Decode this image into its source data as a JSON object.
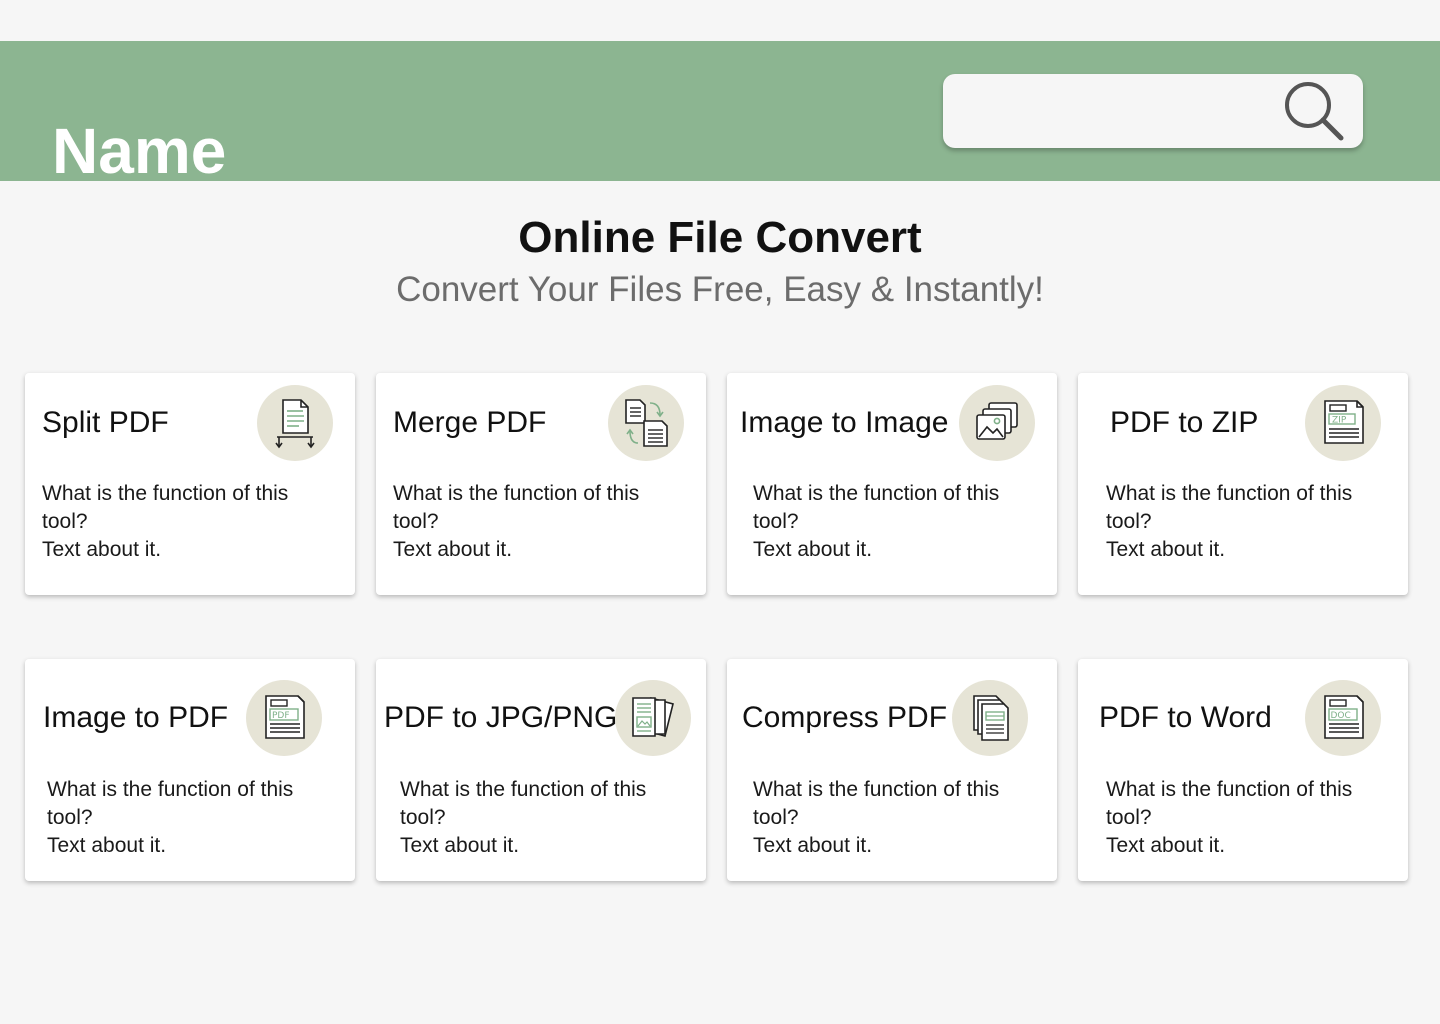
{
  "header": {
    "brand": "Name",
    "search": {
      "placeholder": "",
      "value": ""
    }
  },
  "hero": {
    "title": "Online File Convert",
    "subtitle": "Convert Your Files Free, Easy & Instantly!"
  },
  "tools": [
    {
      "title": "Split PDF",
      "icon": "split-pdf-icon",
      "desc_line1": "What is the function of this",
      "desc_line2": "tool?",
      "desc_line3": "Text about it."
    },
    {
      "title": "Merge PDF",
      "icon": "merge-pdf-icon",
      "desc_line1": "What is the function of this",
      "desc_line2": "tool?",
      "desc_line3": "Text about it."
    },
    {
      "title": "Image to Image",
      "icon": "image-to-image-icon",
      "desc_line1": "What is the function of this",
      "desc_line2": "tool?",
      "desc_line3": "Text about it."
    },
    {
      "title": "PDF to ZIP",
      "icon": "pdf-to-zip-icon",
      "icon_label": "ZIP",
      "desc_line1": "What is the function of this",
      "desc_line2": "tool?",
      "desc_line3": "Text about it."
    },
    {
      "title": "Image to PDF",
      "icon": "image-to-pdf-icon",
      "icon_label": "PDF",
      "desc_line1": "What is the function of this",
      "desc_line2": "tool?",
      "desc_line3": "Text about it."
    },
    {
      "title": "PDF to JPG/PNG",
      "icon": "pdf-to-jpg-png-icon",
      "desc_line1": "What is the function of this",
      "desc_line2": "tool?",
      "desc_line3": "Text about it."
    },
    {
      "title": "Compress PDF",
      "icon": "compress-pdf-icon",
      "desc_line1": "What is the function of this",
      "desc_line2": "tool?",
      "desc_line3": "Text about it."
    },
    {
      "title": "PDF to Word",
      "icon": "pdf-to-word-icon",
      "icon_label": "DOC",
      "desc_line1": "What is the function of this",
      "desc_line2": "tool?",
      "desc_line3": "Text about it."
    }
  ],
  "colors": {
    "header": "#8cb591",
    "background": "#f6f6f6",
    "icon_circle": "#e6e4d6",
    "icon_accent": "#7fb089"
  }
}
